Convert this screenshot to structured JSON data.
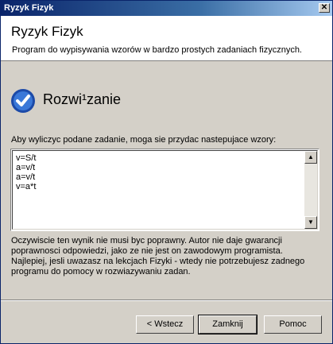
{
  "window": {
    "title": "Ryzyk Fizyk",
    "close_glyph": "✕"
  },
  "header": {
    "title": "Ryzyk Fizyk",
    "subtitle": "Program do wypisywania wzorów w bardzo prostych zadaniach fizycznych."
  },
  "section": {
    "title": "Rozwi¹zanie",
    "icon": "check-icon",
    "accent": "#2860c8"
  },
  "description": "Aby wyliczyc podane zadanie, moga sie przydac nastepujace wzory:",
  "formulas": [
    "v=S/t",
    "a=v/t",
    "a=v/t",
    "v=a*t"
  ],
  "notes": [
    "Oczywiscie ten wynik nie musi byc poprawny. Autor nie daje gwarancji",
    "poprawnosci odpowiedzi, jako ze nie jest on zawodowym programista.",
    "Najlepiej, jesli uwazasz na lekcjach Fizyki - wtedy nie potrzebujesz zadnego",
    "programu do pomocy w rozwiazywaniu zadan."
  ],
  "buttons": {
    "back": "< Wstecz",
    "close": "Zamknij",
    "help": "Pomoc"
  },
  "scrollbar": {
    "up_glyph": "▲",
    "down_glyph": "▼"
  }
}
